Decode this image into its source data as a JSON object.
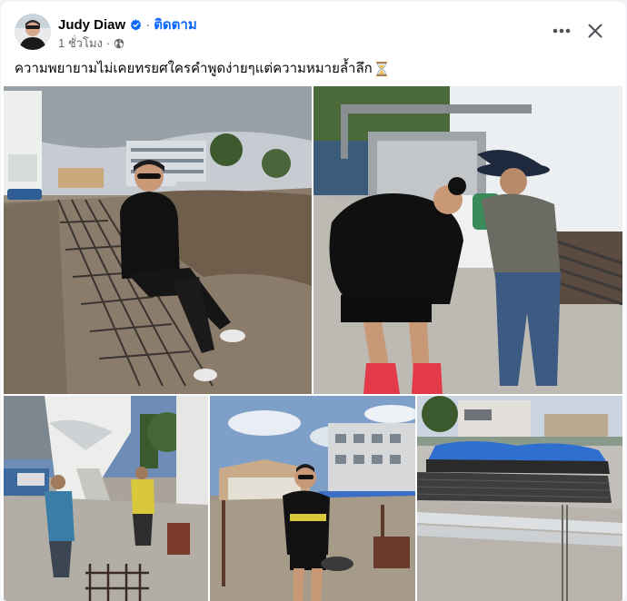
{
  "post": {
    "author": "Judy Diaw",
    "follow_label": "ติดตาม",
    "time": "1 ชั่วโมง",
    "privacy_icon": "globe-icon",
    "caption": "ความพยายามไม่เคยทรยศใครคำพูดง่ายๆแต่ความหมายล้ำลึก",
    "caption_emoji": "hourglass-icon"
  },
  "photos": [
    {
      "name": "construction-site-sitting-photo",
      "icon": "photo"
    },
    {
      "name": "workers-pushing-cart-photo",
      "icon": "photo"
    },
    {
      "name": "concrete-truck-photo",
      "icon": "photo"
    },
    {
      "name": "walking-on-site-photo",
      "icon": "photo"
    },
    {
      "name": "steel-pipes-photo",
      "icon": "photo"
    }
  ],
  "colors": {
    "accent": "#0866ff",
    "text_primary": "#050505",
    "text_secondary": "#65676b",
    "verified": "#0866ff"
  }
}
